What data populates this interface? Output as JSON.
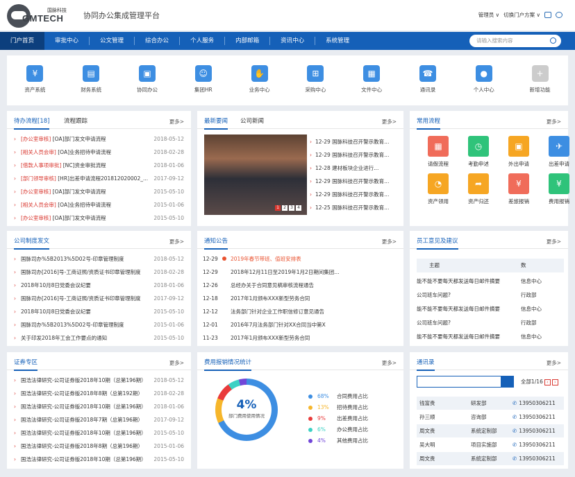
{
  "header": {
    "logo_cn": "国脉科技",
    "logo_en": "GMTECH",
    "title": "协同办公集成管理平台",
    "user": "管理员 ∨",
    "portal_switch": "切换门户方案 ∨"
  },
  "nav": {
    "items": [
      "门户首页",
      "审批中心",
      "公文管理",
      "综合办公",
      "个人服务",
      "内部邮箱",
      "资讯中心",
      "系统管理"
    ],
    "search_placeholder": "请输入搜索内容"
  },
  "apps": [
    {
      "label": "资产系统",
      "icon": "asset-icon"
    },
    {
      "label": "财务系统",
      "icon": "finance-icon"
    },
    {
      "label": "协同办公",
      "icon": "office-icon"
    },
    {
      "label": "集团HR",
      "icon": "hr-icon"
    },
    {
      "label": "业务中心",
      "icon": "business-icon"
    },
    {
      "label": "采购中心",
      "icon": "cart-icon"
    },
    {
      "label": "文件中心",
      "icon": "file-icon"
    },
    {
      "label": "通讯录",
      "icon": "contacts-icon"
    },
    {
      "label": "个人中心",
      "icon": "user-icon"
    },
    {
      "label": "新增功能",
      "icon": "plus-icon"
    }
  ],
  "todo": {
    "tab1": "待办流程[18]",
    "tab2": "流程跟踪",
    "more": "更多>",
    "rows": [
      {
        "tag": "[办公室审核]",
        "text": "[OA]部门发文申请流程",
        "date": "2018-05-12"
      },
      {
        "tag": "[相关人员会审]",
        "text": "[OA]业务招待申请流程",
        "date": "2018-02-28"
      },
      {
        "tag": "[借款人事项审批]",
        "text": "[NC]资金审批流程",
        "date": "2018-01-06"
      },
      {
        "tag": "[部门领导审核]",
        "text": "[HR]出差申请流程2018120200​02_...",
        "date": "2017-09-12"
      },
      {
        "tag": "[办公室审核]",
        "text": "[OA]部门发文申请流程",
        "date": "2015-05-10"
      },
      {
        "tag": "[相关人员会审]",
        "text": "[OA]业务招待申请流程",
        "date": "2015-01-06"
      },
      {
        "tag": "[办公室审核]",
        "text": "[OA]部门发文申请流程",
        "date": "2015-05-10"
      }
    ]
  },
  "news": {
    "tab1": "最新要闻",
    "tab2": "公司新闻",
    "more": "更多>",
    "slides": [
      "1",
      "2",
      "3",
      "4"
    ],
    "rows": [
      "12-29 国脉科技召开警示教育...",
      "12-29 国脉科技召开警示教育...",
      "12-28 建材板块企业进行...",
      "12-29 国脉科技召开警示教育...",
      "12-29 国脉科技召开警示教育...",
      "12-25 国脉科技召开警示教育..."
    ]
  },
  "common": {
    "title": "常用流程",
    "more": "更多>",
    "items": [
      {
        "label": "请假流程",
        "color": "#f06c5a",
        "icon": "calendar-icon"
      },
      {
        "label": "考勤申述",
        "color": "#2fc37a",
        "icon": "clock-icon"
      },
      {
        "label": "外出申请",
        "color": "#f6a623",
        "icon": "outing-icon"
      },
      {
        "label": "出差申请",
        "color": "#3d8ee2",
        "icon": "plane-icon"
      },
      {
        "label": "资产领用",
        "color": "#f6a623",
        "icon": "pie-icon"
      },
      {
        "label": "资产归还",
        "color": "#f6a623",
        "icon": "return-icon"
      },
      {
        "label": "差旅报销",
        "color": "#f06c5a",
        "icon": "money-icon"
      },
      {
        "label": "费用报销",
        "color": "#2fc37a",
        "icon": "yuan-icon"
      }
    ]
  },
  "policy": {
    "title": "公司制度发文",
    "more": "更多>",
    "rows": [
      {
        "text": "国脉司办%5B2013%5D02号-印章管理制度",
        "date": "2018-05-12"
      },
      {
        "text": "国脉司办[2016]号-工商证照/资质证书印章管理制度",
        "date": "2018-02-28"
      },
      {
        "text": "2018年10月8日党委会议纪要",
        "date": "2018-01-06"
      },
      {
        "text": "国脉司办[2016]号-工商证照/资质证书印章管理制度",
        "date": "2017-09-12"
      },
      {
        "text": "2018年10月8日党委会议纪要",
        "date": "2015-05-10"
      },
      {
        "text": "国脉司办%5B2013%5D02号-印章管理制度",
        "date": "2015-01-06"
      },
      {
        "text": "关于印发2018年工会工作要点的通知",
        "date": "2015-05-10"
      }
    ]
  },
  "notice": {
    "title": "通知公告",
    "more": "更多>",
    "rows": [
      {
        "date": "12-29",
        "text": "2019年春节带班、值班安排表"
      },
      {
        "date": "12-29",
        "text": "2018年12月11日至2019年1月2日期间集团..."
      },
      {
        "date": "12-26",
        "text": "总经办关于合同意见稿审核流程通告"
      },
      {
        "date": "12-18",
        "text": "2017年1月颁布XXX新型劳务合同"
      },
      {
        "date": "12-12",
        "text": "法务部门针对企业工作职信修订意见通告"
      },
      {
        "date": "12-01",
        "text": "2016年7月法务部门针对XX合同当中第X"
      },
      {
        "date": "11-23",
        "text": "2017年1月颁布XXX新型劳务合同"
      }
    ]
  },
  "feedback": {
    "title": "员工意见及建议",
    "more": "更多>",
    "col1": "主题",
    "col2": "数",
    "rows": [
      {
        "topic": "能不能不要每天都发送每日邮件摘要",
        "dept": "信息中心"
      },
      {
        "topic": "公司班车问题?",
        "dept": "行政部"
      },
      {
        "topic": "能不能不要每天都发送每日邮件摘要",
        "dept": "信息中心"
      },
      {
        "topic": "公司班车问题?",
        "dept": "行政部"
      },
      {
        "topic": "能不能不要每天都发送每日邮件摘要",
        "dept": "信息中心"
      }
    ]
  },
  "securities": {
    "title": "证券专区",
    "more": "更多>",
    "rows": [
      {
        "text": "国浩法律研究-公司证券版2018年10期（总第196期）",
        "date": "2018-05-12"
      },
      {
        "text": "国浩法律研究-公司证券版2018年8期（总第192期）",
        "date": "2018-02-28"
      },
      {
        "text": "国浩法律研究-公司证券版2018年10期（总第196期）",
        "date": "2018-01-06"
      },
      {
        "text": "国浩法律研究-公司证券版2018年7期（总第196期）",
        "date": "2017-09-12"
      },
      {
        "text": "国浩法律研究-公司证券版2018年10期（总第196期）",
        "date": "2015-05-10"
      },
      {
        "text": "国浩法律研究-公司证券版2018年8期（总第196期）",
        "date": "2015-01-06"
      },
      {
        "text": "国浩法律研究-公司证券版2018年10期（总第196期）",
        "date": "2015-05-10"
      }
    ]
  },
  "expense": {
    "title": "费用报销情况统计",
    "more": "更多>",
    "center_value": "4%",
    "center_label": "部门费用使用情况"
  },
  "chart_data": {
    "type": "pie",
    "slices": [
      {
        "label": "合同费用占比",
        "value": 68,
        "display": "68%",
        "color": "#3d8ee2"
      },
      {
        "label": "招待费用占比",
        "value": 13,
        "display": "13%",
        "color": "#f6b62b"
      },
      {
        "label": "出差费用占比",
        "value": 9,
        "display": "9%",
        "color": "#e93b3b"
      },
      {
        "label": "办公费用占比",
        "value": 6,
        "display": "6%",
        "color": "#3cd1c4"
      },
      {
        "label": "其他费用占比",
        "value": 4,
        "display": "4%",
        "color": "#7146d8"
      }
    ]
  },
  "contacts": {
    "title": "通讯录",
    "more": "更多>",
    "page": "全部1/16",
    "rows": [
      {
        "name": "钱富贵",
        "dept": "研发部",
        "phone": "13950306211"
      },
      {
        "name": "孙三顺",
        "dept": "咨询部",
        "phone": "13950306211"
      },
      {
        "name": "周文贵",
        "dept": "系统定制部",
        "phone": "13950306211"
      },
      {
        "name": "吴大明",
        "dept": "项目实施部",
        "phone": "13950306211"
      },
      {
        "name": "周文贵",
        "dept": "系统定制部",
        "phone": "13950306211"
      }
    ]
  }
}
